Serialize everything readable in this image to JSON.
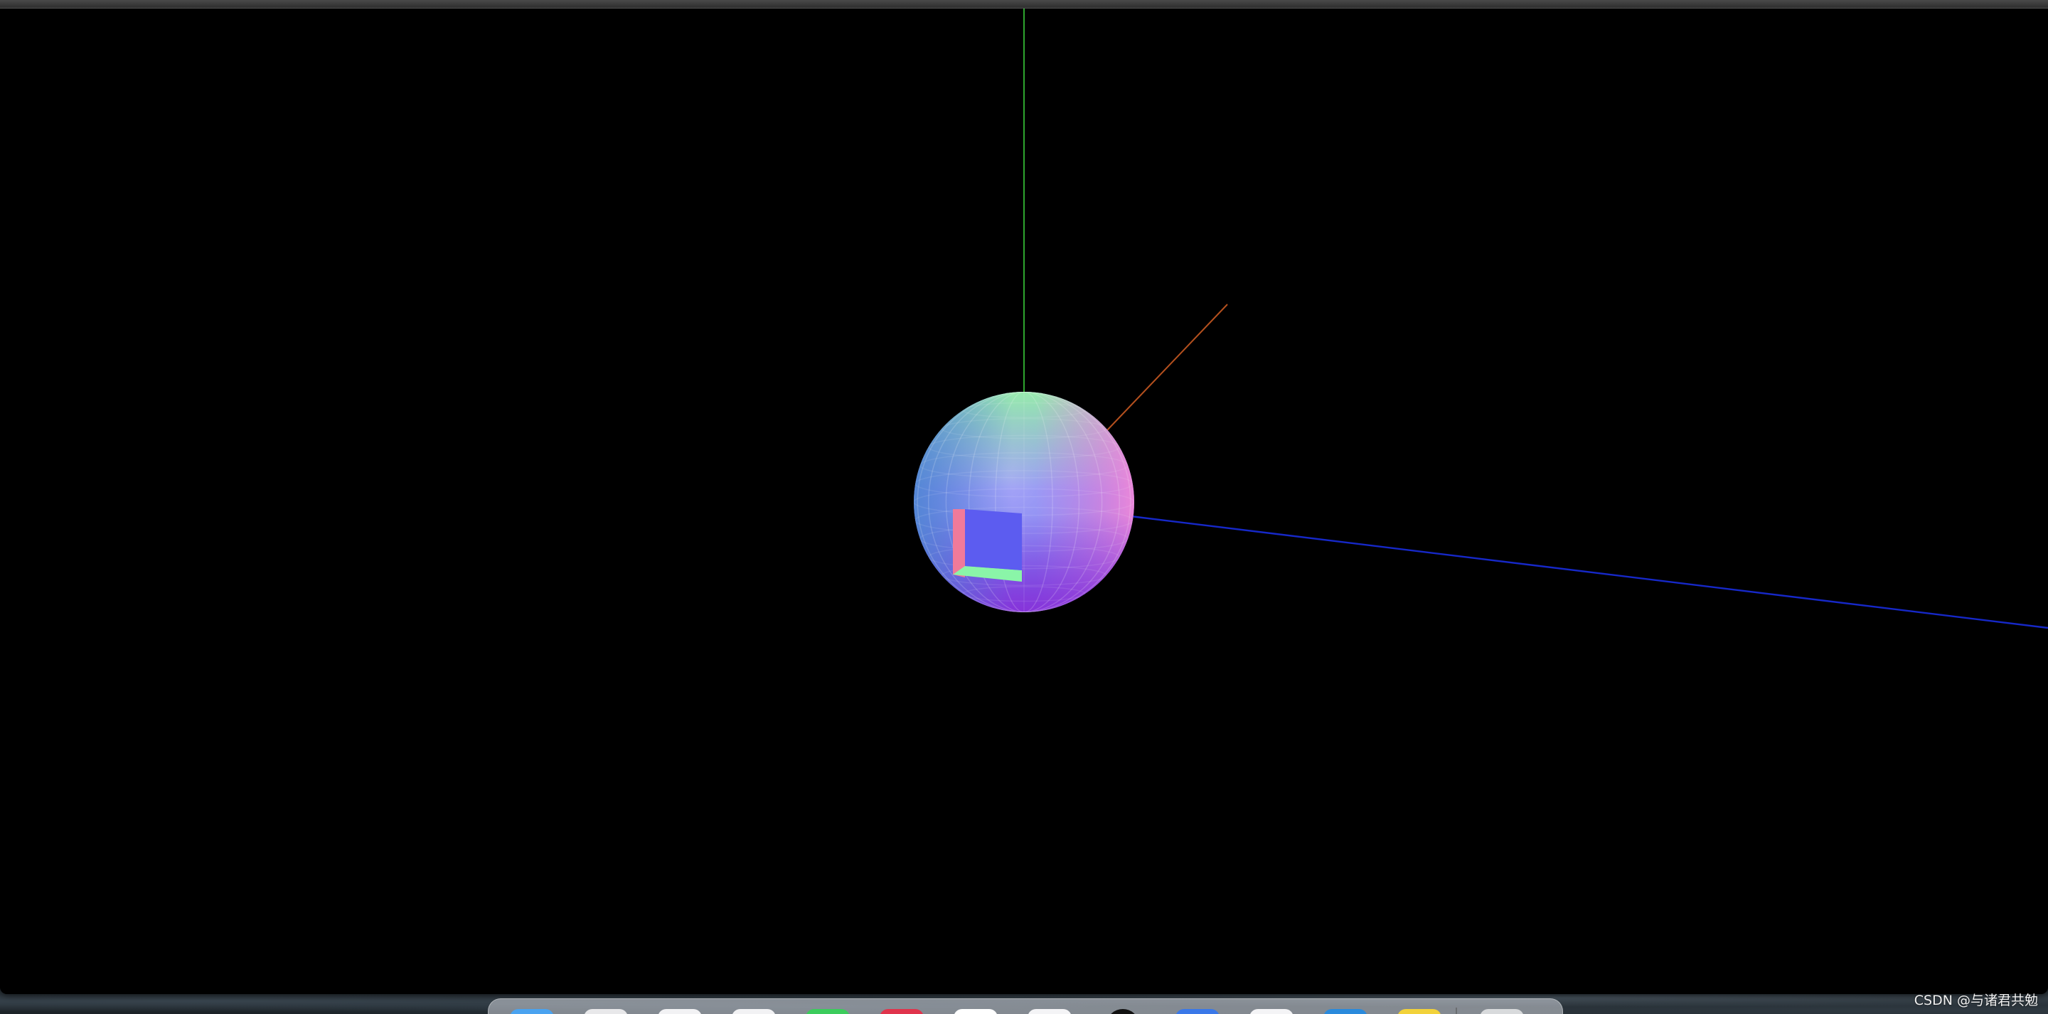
{
  "scene": {
    "background": "#000000",
    "axes": {
      "x_color": "#b4501e",
      "y_color": "#2fa52f",
      "z_color": "#1628c8"
    },
    "sphere": {
      "material": "normal",
      "colors": {
        "top": "#9af5a8",
        "right": "#f08ce0",
        "bottom": "#7a32e0",
        "left": "#5a6ad8",
        "center": "#8a8af5"
      }
    },
    "box": {
      "material": "normal",
      "front_color": "#5c5cf0",
      "left_color": "#f07a9a",
      "bottom_color": "#8af5a8"
    }
  },
  "dock": {
    "icons": [
      {
        "name": "finder-icon",
        "color": "#4aa3f0"
      },
      {
        "name": "launchpad-icon",
        "color": "#e8e8ea"
      },
      {
        "name": "safari-icon",
        "color": "#f2f2f4"
      },
      {
        "name": "mail-icon",
        "color": "#f2f2f4"
      },
      {
        "name": "messages-icon",
        "color": "#3ccc5c"
      },
      {
        "name": "music-icon",
        "color": "#e0344c"
      },
      {
        "name": "notes-icon",
        "color": "#ffffff"
      },
      {
        "name": "preview-icon",
        "color": "#f4f4f6"
      },
      {
        "name": "terminal-icon",
        "color": "#111111"
      },
      {
        "name": "chrome-icon",
        "color": "#3a78e8"
      },
      {
        "name": "textedit-icon",
        "color": "#f4f4f6"
      },
      {
        "name": "vscode-icon",
        "color": "#2a8adc"
      },
      {
        "name": "app-store-icon",
        "color": "#f2d23a"
      },
      {
        "name": "trash-icon",
        "color": "#d8dadc"
      }
    ]
  },
  "watermark": {
    "text": "CSDN @与诸君共勉"
  }
}
